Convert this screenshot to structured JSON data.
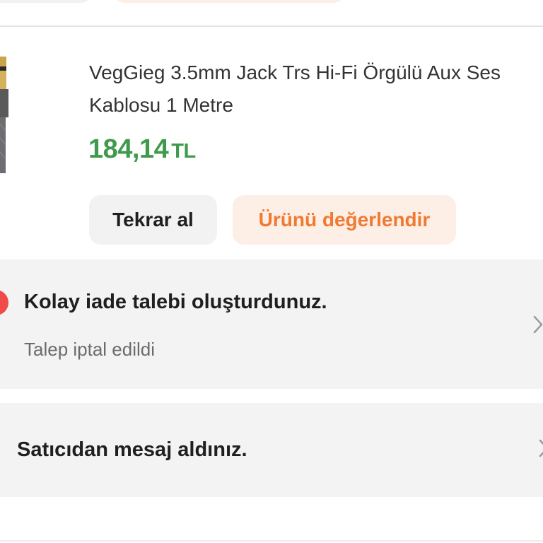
{
  "product": {
    "title_line1": "VegGieg 3.5mm Jack Trs Hi-Fi Örgülü Aux Ses",
    "title_line2": "Kablosu 1 Metre",
    "price_amount": "184,14",
    "price_currency": "TL",
    "image_icon": "aux-cable-thumbnail"
  },
  "actions": {
    "rebuy_label": "Tekrar al",
    "review_label": "Ürünü değerlendir"
  },
  "return_card": {
    "title": "Kolay iade talebi oluşturdunuz.",
    "status": "Talep iptal edildi",
    "status_icon": "red-dot-icon",
    "arrow_icon": "chevron-right-icon"
  },
  "message_card": {
    "title": "Satıcıdan mesaj aldınız.",
    "arrow_icon": "chevron-right-icon"
  },
  "colors": {
    "price_green": "#3f9a4b",
    "accent_orange": "#f07a31",
    "review_bg": "#fdeee6",
    "alert_red": "#f04a4a",
    "card_bg": "#f3f3f3"
  }
}
